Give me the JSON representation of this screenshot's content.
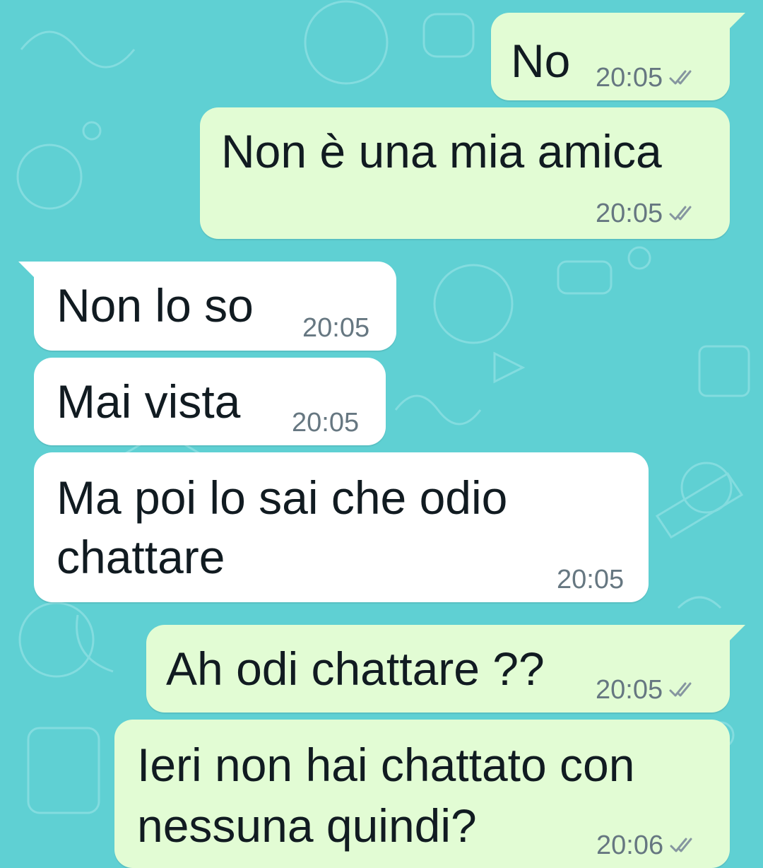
{
  "chat": {
    "background_color": "#5fd0d3",
    "outgoing_color": "#e2fcd4",
    "incoming_color": "#ffffff",
    "read_tick_icon": "double-check-icon",
    "messages": [
      {
        "direction": "outgoing",
        "lines": [
          "No"
        ],
        "time": "20:05",
        "status": "read"
      },
      {
        "direction": "outgoing",
        "lines": [
          "Non è una mia amica"
        ],
        "time": "20:05",
        "status": "read"
      },
      {
        "direction": "incoming",
        "lines": [
          "Non lo so"
        ],
        "time": "20:05"
      },
      {
        "direction": "incoming",
        "lines": [
          "Mai vista"
        ],
        "time": "20:05"
      },
      {
        "direction": "incoming",
        "lines": [
          "Ma poi lo sai che odio",
          "chattare"
        ],
        "time": "20:05"
      },
      {
        "direction": "outgoing",
        "lines": [
          "Ah odi chattare ??"
        ],
        "time": "20:05",
        "status": "read"
      },
      {
        "direction": "outgoing",
        "lines": [
          "Ieri non hai chattato con",
          "nessuna quindi?"
        ],
        "time": "20:06",
        "status": "read"
      }
    ]
  }
}
